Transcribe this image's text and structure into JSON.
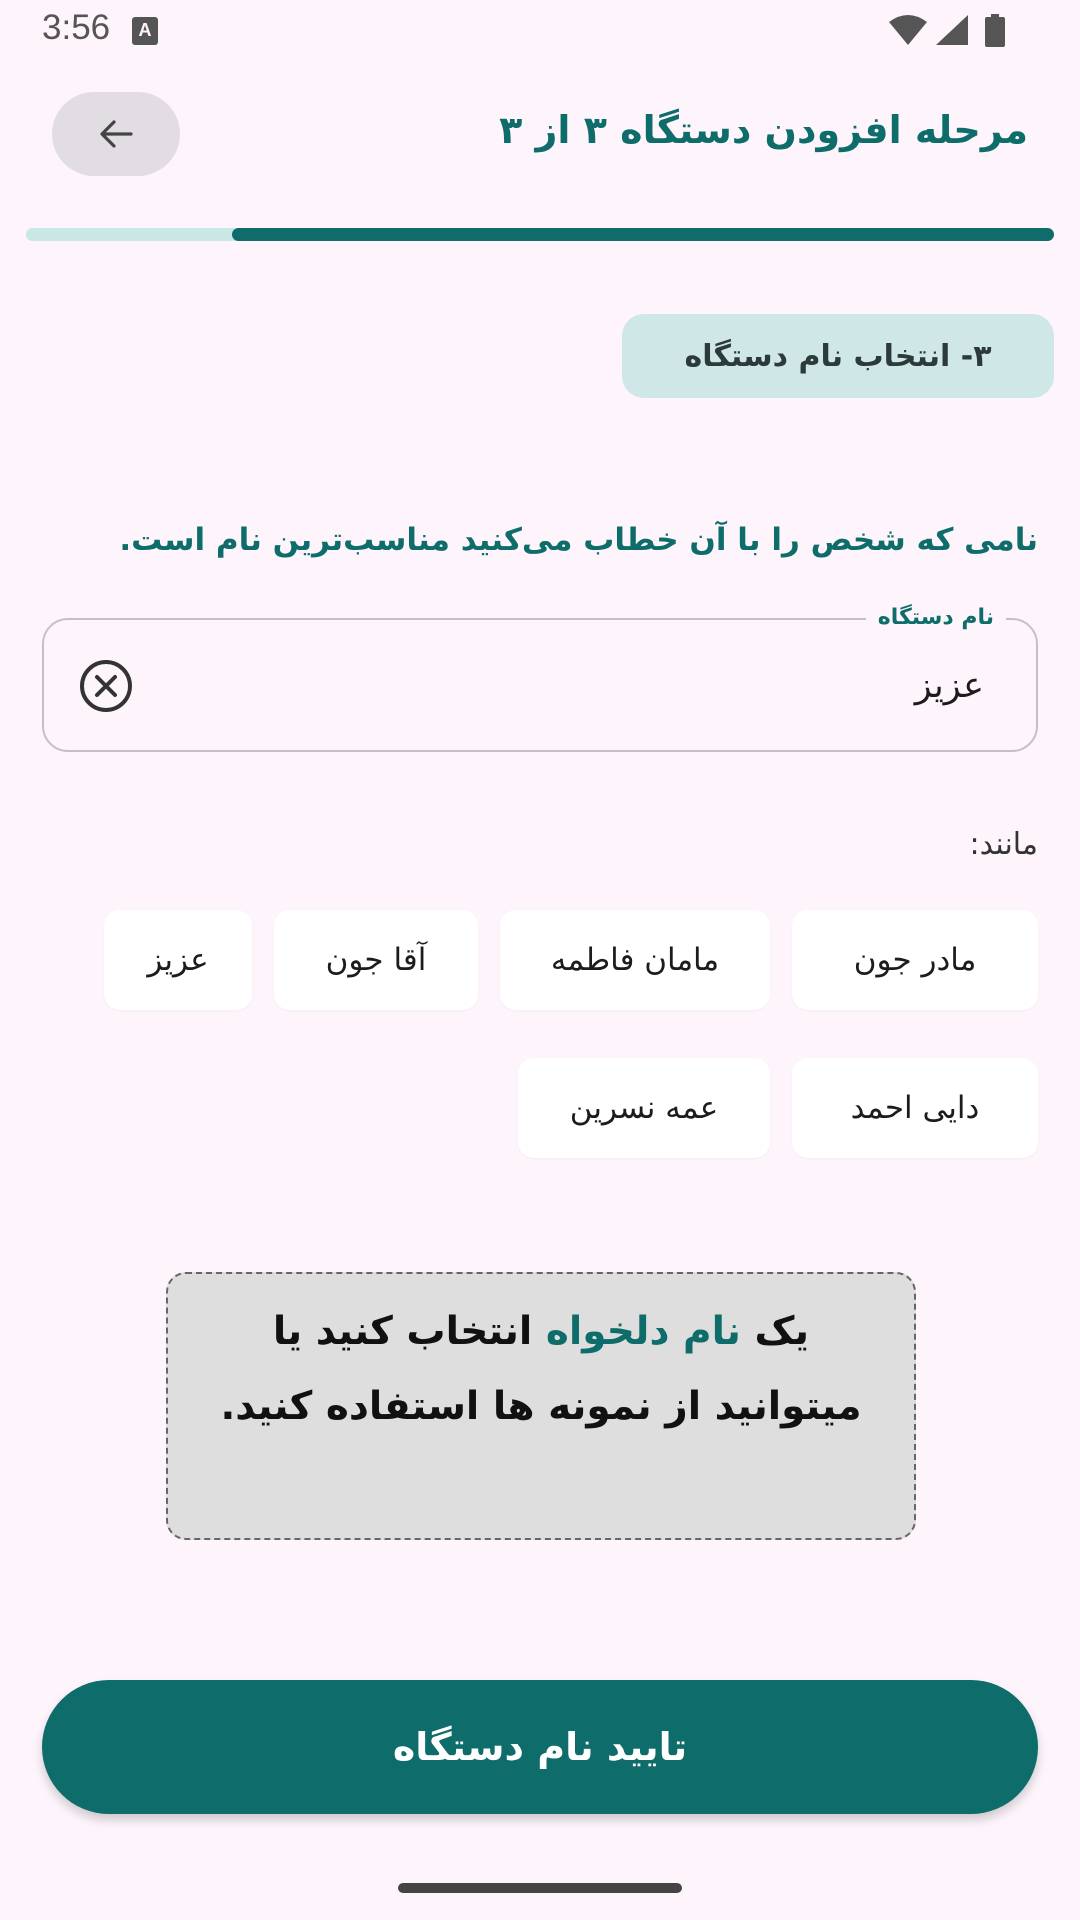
{
  "status_bar": {
    "time": "3:56",
    "notification_badge": "A",
    "icons": [
      "wifi-icon",
      "signal-icon",
      "battery-icon"
    ]
  },
  "header": {
    "back_icon": "arrow-left-icon",
    "title": "مرحله افزودن دستگاه ۳ از ۳"
  },
  "progress": {
    "value": 0.8
  },
  "step": {
    "label": "۳- انتخاب نام دستگاه"
  },
  "instruction": "نامی که شخص را با آن خطاب می‌کنید مناسب‌ترین نام است.",
  "name_field": {
    "label": "نام دستگاه",
    "value": "عزیز",
    "clear_icon": "clear-circle-icon"
  },
  "examples": {
    "label": "مانند:",
    "items": [
      "مادر جون",
      "مامان فاطمه",
      "آقا جون",
      "عزیز",
      "دایی احمد",
      "عمه نسرین"
    ]
  },
  "hint": {
    "part1": "یک ",
    "highlight": "نام دلخواه",
    "part2": " انتخاب کنید یا میتوانید از نمونه ها استفاده کنید."
  },
  "confirm_button": {
    "label": "تایید نام دستگاه"
  },
  "colors": {
    "primary": "#0e6d6b",
    "background": "#fdf5fb",
    "progress_track": "#c8e7e5",
    "step_chip": "#cfe7e7"
  }
}
